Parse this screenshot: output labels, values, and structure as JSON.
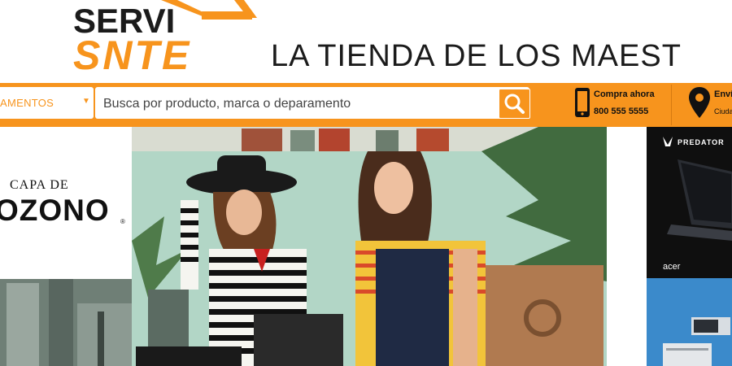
{
  "logo": {
    "line1": "SERVI",
    "line2": "SNTE"
  },
  "header": {
    "tagline": "LA TIENDA DE LOS MAEST"
  },
  "nav": {
    "department_label": "AMENTOS",
    "search_placeholder": "Busca por producto, marca o deparamento"
  },
  "contact": {
    "buy_label": "Compra ahora",
    "phone": "800 555 5555"
  },
  "shipping": {
    "label": "Enví",
    "sub": "Ciuda"
  },
  "promos": {
    "ozone_top": "CAPA DE",
    "ozone_main": "OZONO",
    "ozone_reg": "®",
    "predator_brand": "PREDATOR",
    "acer_brand": "acer"
  },
  "colors": {
    "accent": "#f7941d",
    "text": "#1b1b1b"
  }
}
